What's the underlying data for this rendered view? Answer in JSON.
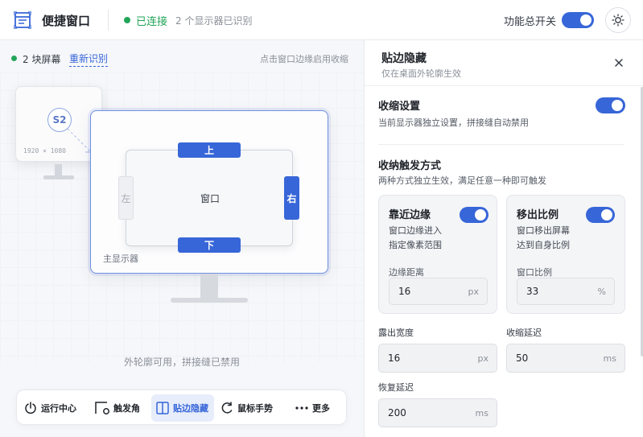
{
  "header": {
    "title": "便捷窗口",
    "status": "已连接",
    "status_sub": "2 个显示器已识别",
    "master_toggle_label": "功能总开关",
    "master_toggle_on": true
  },
  "left": {
    "screens_count": "2 块屏幕",
    "redetect": "重新识别",
    "hint": "点击窗口边缘启用收缩",
    "secondary_badge": "S2",
    "secondary_res": "1920 × 1080",
    "main_monitor_label": "主显示器",
    "window_label": "窗口",
    "edges": {
      "top": "上",
      "bottom": "下",
      "left": "左",
      "right": "右"
    },
    "bottom_hint": "外轮廓可用，拼接缝已禁用"
  },
  "nav": [
    {
      "label": "运行中心",
      "icon": "power-icon",
      "active": false
    },
    {
      "label": "触发角",
      "icon": "corner-icon",
      "active": false
    },
    {
      "label": "贴边隐藏",
      "icon": "split-panel-icon",
      "active": true
    },
    {
      "label": "鼠标手势",
      "icon": "gesture-icon",
      "active": false
    },
    {
      "label": "更多",
      "icon": "more-icon",
      "active": false
    }
  ],
  "panel": {
    "title": "贴边隐藏",
    "subtitle": "仅在桌面外轮廓生效",
    "shrink_title": "收缩设置",
    "shrink_desc": "当前显示器独立设置，拼接缝自动禁用",
    "trigger_title": "收纳触发方式",
    "trigger_desc": "两种方式独立生效，满足任意一种即可触发",
    "card_edge": {
      "title": "靠近边缘",
      "desc1": "窗口边缘进入",
      "desc2": "指定像素范围",
      "field_label": "边缘距离",
      "value": "16",
      "unit": "px"
    },
    "card_ratio": {
      "title": "移出比例",
      "desc1": "窗口移出屏幕",
      "desc2": "达到自身比例",
      "field_label": "窗口比例",
      "value": "33",
      "unit": "%"
    },
    "reveal_width": {
      "label": "露出宽度",
      "value": "16",
      "unit": "px"
    },
    "shrink_delay": {
      "label": "收缩延迟",
      "value": "50",
      "unit": "ms"
    },
    "restore_delay": {
      "label": "恢复延迟",
      "value": "200",
      "unit": "ms"
    }
  },
  "colors": {
    "accent": "#3766d8",
    "success": "#22a559"
  }
}
